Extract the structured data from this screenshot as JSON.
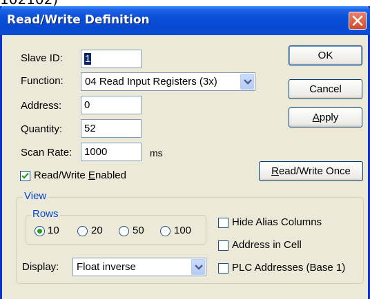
{
  "page_fragment": "102102)",
  "window": {
    "title": "Read/Write Definition",
    "close_icon": "close-icon"
  },
  "form": {
    "slave_id": {
      "label": "Slave ID:",
      "value": "1"
    },
    "function": {
      "label": "Function:",
      "value": "04 Read Input Registers (3x)"
    },
    "address": {
      "label": "Address:",
      "value": "0"
    },
    "quantity": {
      "label": "Quantity:",
      "value": "52"
    },
    "scan_rate": {
      "label": "Scan Rate:",
      "value": "1000",
      "unit": "ms"
    },
    "rw_enabled": {
      "label_pre": "Read/Write ",
      "label_u": "E",
      "label_post": "nabled",
      "checked": true
    }
  },
  "buttons": {
    "ok": "OK",
    "cancel": "Cancel",
    "apply_u": "A",
    "apply_rest": "pply",
    "rw_once_u": "R",
    "rw_once_rest": "ead/Write Once"
  },
  "view": {
    "title": "View",
    "rows": {
      "title": "Rows",
      "options": [
        "10",
        "20",
        "50",
        "100"
      ],
      "selected": "10"
    },
    "display": {
      "label": "Display:",
      "value": "Float inverse"
    },
    "hide_alias": {
      "label": "Hide Alias Columns",
      "checked": false
    },
    "address_in_cell": {
      "label": "Address in Cell",
      "checked": false
    },
    "plc_addresses": {
      "label": "PLC Addresses (Base 1)",
      "checked": false
    }
  },
  "colors": {
    "titlebar": "#0a4fd8",
    "dialog_bg": "#ece9d8",
    "group_label": "#0046d5",
    "close_button": "#d24a2c"
  }
}
